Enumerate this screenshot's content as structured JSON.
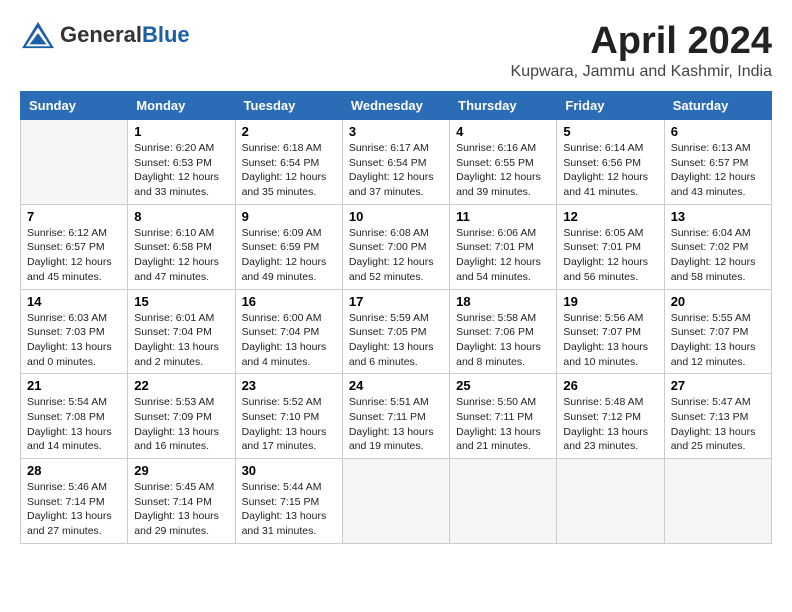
{
  "header": {
    "logo_general": "General",
    "logo_blue": "Blue",
    "title": "April 2024",
    "location": "Kupwara, Jammu and Kashmir, India"
  },
  "weekdays": [
    "Sunday",
    "Monday",
    "Tuesday",
    "Wednesday",
    "Thursday",
    "Friday",
    "Saturday"
  ],
  "weeks": [
    [
      {
        "day": null
      },
      {
        "day": "1",
        "sunrise": "Sunrise: 6:20 AM",
        "sunset": "Sunset: 6:53 PM",
        "daylight": "Daylight: 12 hours and 33 minutes."
      },
      {
        "day": "2",
        "sunrise": "Sunrise: 6:18 AM",
        "sunset": "Sunset: 6:54 PM",
        "daylight": "Daylight: 12 hours and 35 minutes."
      },
      {
        "day": "3",
        "sunrise": "Sunrise: 6:17 AM",
        "sunset": "Sunset: 6:54 PM",
        "daylight": "Daylight: 12 hours and 37 minutes."
      },
      {
        "day": "4",
        "sunrise": "Sunrise: 6:16 AM",
        "sunset": "Sunset: 6:55 PM",
        "daylight": "Daylight: 12 hours and 39 minutes."
      },
      {
        "day": "5",
        "sunrise": "Sunrise: 6:14 AM",
        "sunset": "Sunset: 6:56 PM",
        "daylight": "Daylight: 12 hours and 41 minutes."
      },
      {
        "day": "6",
        "sunrise": "Sunrise: 6:13 AM",
        "sunset": "Sunset: 6:57 PM",
        "daylight": "Daylight: 12 hours and 43 minutes."
      }
    ],
    [
      {
        "day": "7",
        "sunrise": "Sunrise: 6:12 AM",
        "sunset": "Sunset: 6:57 PM",
        "daylight": "Daylight: 12 hours and 45 minutes."
      },
      {
        "day": "8",
        "sunrise": "Sunrise: 6:10 AM",
        "sunset": "Sunset: 6:58 PM",
        "daylight": "Daylight: 12 hours and 47 minutes."
      },
      {
        "day": "9",
        "sunrise": "Sunrise: 6:09 AM",
        "sunset": "Sunset: 6:59 PM",
        "daylight": "Daylight: 12 hours and 49 minutes."
      },
      {
        "day": "10",
        "sunrise": "Sunrise: 6:08 AM",
        "sunset": "Sunset: 7:00 PM",
        "daylight": "Daylight: 12 hours and 52 minutes."
      },
      {
        "day": "11",
        "sunrise": "Sunrise: 6:06 AM",
        "sunset": "Sunset: 7:01 PM",
        "daylight": "Daylight: 12 hours and 54 minutes."
      },
      {
        "day": "12",
        "sunrise": "Sunrise: 6:05 AM",
        "sunset": "Sunset: 7:01 PM",
        "daylight": "Daylight: 12 hours and 56 minutes."
      },
      {
        "day": "13",
        "sunrise": "Sunrise: 6:04 AM",
        "sunset": "Sunset: 7:02 PM",
        "daylight": "Daylight: 12 hours and 58 minutes."
      }
    ],
    [
      {
        "day": "14",
        "sunrise": "Sunrise: 6:03 AM",
        "sunset": "Sunset: 7:03 PM",
        "daylight": "Daylight: 13 hours and 0 minutes."
      },
      {
        "day": "15",
        "sunrise": "Sunrise: 6:01 AM",
        "sunset": "Sunset: 7:04 PM",
        "daylight": "Daylight: 13 hours and 2 minutes."
      },
      {
        "day": "16",
        "sunrise": "Sunrise: 6:00 AM",
        "sunset": "Sunset: 7:04 PM",
        "daylight": "Daylight: 13 hours and 4 minutes."
      },
      {
        "day": "17",
        "sunrise": "Sunrise: 5:59 AM",
        "sunset": "Sunset: 7:05 PM",
        "daylight": "Daylight: 13 hours and 6 minutes."
      },
      {
        "day": "18",
        "sunrise": "Sunrise: 5:58 AM",
        "sunset": "Sunset: 7:06 PM",
        "daylight": "Daylight: 13 hours and 8 minutes."
      },
      {
        "day": "19",
        "sunrise": "Sunrise: 5:56 AM",
        "sunset": "Sunset: 7:07 PM",
        "daylight": "Daylight: 13 hours and 10 minutes."
      },
      {
        "day": "20",
        "sunrise": "Sunrise: 5:55 AM",
        "sunset": "Sunset: 7:07 PM",
        "daylight": "Daylight: 13 hours and 12 minutes."
      }
    ],
    [
      {
        "day": "21",
        "sunrise": "Sunrise: 5:54 AM",
        "sunset": "Sunset: 7:08 PM",
        "daylight": "Daylight: 13 hours and 14 minutes."
      },
      {
        "day": "22",
        "sunrise": "Sunrise: 5:53 AM",
        "sunset": "Sunset: 7:09 PM",
        "daylight": "Daylight: 13 hours and 16 minutes."
      },
      {
        "day": "23",
        "sunrise": "Sunrise: 5:52 AM",
        "sunset": "Sunset: 7:10 PM",
        "daylight": "Daylight: 13 hours and 17 minutes."
      },
      {
        "day": "24",
        "sunrise": "Sunrise: 5:51 AM",
        "sunset": "Sunset: 7:11 PM",
        "daylight": "Daylight: 13 hours and 19 minutes."
      },
      {
        "day": "25",
        "sunrise": "Sunrise: 5:50 AM",
        "sunset": "Sunset: 7:11 PM",
        "daylight": "Daylight: 13 hours and 21 minutes."
      },
      {
        "day": "26",
        "sunrise": "Sunrise: 5:48 AM",
        "sunset": "Sunset: 7:12 PM",
        "daylight": "Daylight: 13 hours and 23 minutes."
      },
      {
        "day": "27",
        "sunrise": "Sunrise: 5:47 AM",
        "sunset": "Sunset: 7:13 PM",
        "daylight": "Daylight: 13 hours and 25 minutes."
      }
    ],
    [
      {
        "day": "28",
        "sunrise": "Sunrise: 5:46 AM",
        "sunset": "Sunset: 7:14 PM",
        "daylight": "Daylight: 13 hours and 27 minutes."
      },
      {
        "day": "29",
        "sunrise": "Sunrise: 5:45 AM",
        "sunset": "Sunset: 7:14 PM",
        "daylight": "Daylight: 13 hours and 29 minutes."
      },
      {
        "day": "30",
        "sunrise": "Sunrise: 5:44 AM",
        "sunset": "Sunset: 7:15 PM",
        "daylight": "Daylight: 13 hours and 31 minutes."
      },
      {
        "day": null
      },
      {
        "day": null
      },
      {
        "day": null
      },
      {
        "day": null
      }
    ]
  ]
}
